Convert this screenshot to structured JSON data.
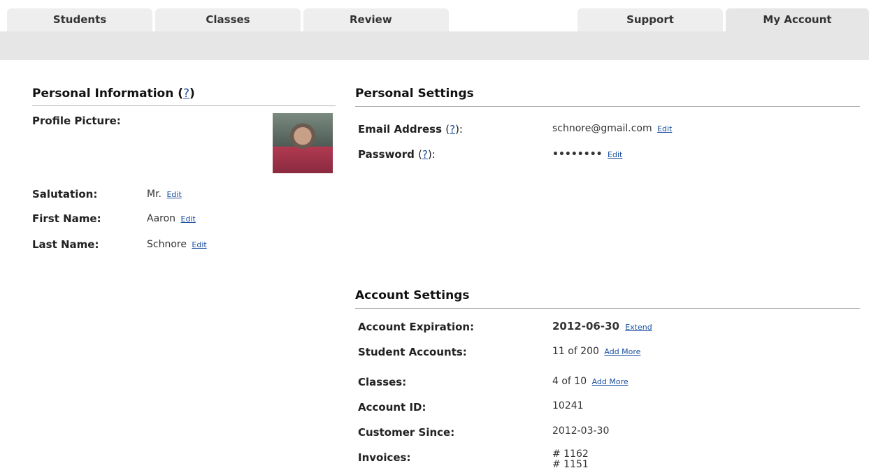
{
  "tabs": [
    {
      "label": "Students"
    },
    {
      "label": "Classes"
    },
    {
      "label": "Review"
    },
    {
      "label": "Support"
    },
    {
      "label": "My Account"
    }
  ],
  "personal_info": {
    "heading": "Personal Information",
    "help": "?",
    "profile_picture_label": "Profile Picture:",
    "salutation_label": "Salutation:",
    "salutation_value": "Mr.",
    "first_name_label": "First Name:",
    "first_name_value": "Aaron",
    "last_name_label": "Last Name:",
    "last_name_value": "Schnore",
    "edit": "Edit"
  },
  "personal_settings": {
    "heading": "Personal Settings",
    "email_label": "Email Address",
    "email_value": "schnore@gmail.com",
    "password_label": "Password",
    "password_value": "••••••••",
    "help": "?",
    "colon": "):",
    "edit": "Edit"
  },
  "account_settings": {
    "heading": "Account Settings",
    "expiration_label": "Account Expiration:",
    "expiration_value": "2012-06-30",
    "extend": "Extend",
    "student_accounts_label": "Student Accounts:",
    "student_accounts_value": "11 of 200",
    "classes_label": "Classes:",
    "classes_value": "4 of 10",
    "add_more": "Add More",
    "account_id_label": "Account ID:",
    "account_id_value": "10241",
    "customer_since_label": "Customer Since:",
    "customer_since_value": "2012-03-30",
    "invoices_label": "Invoices:",
    "invoices": [
      "# 1162",
      "# 1151"
    ]
  }
}
